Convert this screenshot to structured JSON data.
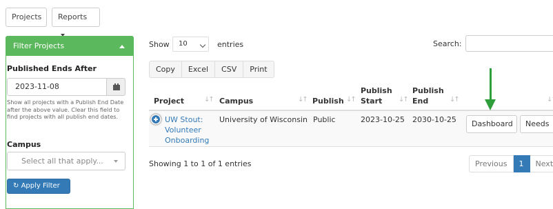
{
  "topnav": {
    "projects": "Projects",
    "reports": "Reports"
  },
  "filter": {
    "title": "Filter Projects",
    "published_label": "Published Ends After",
    "date_value": "2023-11-08",
    "help_text": "Show all projects with a Publish End Date after the above value. Clear this field to find projects with all publish end dates.",
    "campus_label": "Campus",
    "campus_placeholder": "Select all that apply...",
    "apply": "Apply Filter",
    "apply_icon": "↻"
  },
  "table_controls": {
    "show": "Show",
    "entries_value": "10",
    "entries": "entries",
    "search": "Search:"
  },
  "export": [
    "Copy",
    "Excel",
    "CSV",
    "Print"
  ],
  "columns": {
    "project": "Project",
    "campus": "Campus",
    "publish": "Publish",
    "publish_start": [
      "Publish",
      "Start"
    ],
    "publish_end": [
      "Publish",
      "End"
    ]
  },
  "row": {
    "project": [
      "UW Stout:",
      "Volunteer",
      "Onboarding"
    ],
    "campus": "University of Wisconsin",
    "publish": "Public",
    "start": "2023-10-25",
    "end": "2030-10-25",
    "dashboard": "Dashboard",
    "needs": "Needs"
  },
  "footer": {
    "info": "Showing 1 to 1 of 1 entries",
    "previous": "Previous",
    "page": "1",
    "next": "Next"
  },
  "colors": {
    "panel_header": "#5cb85c",
    "primary": "#337ab7",
    "annotation_arrow": "#2e9e3a"
  }
}
